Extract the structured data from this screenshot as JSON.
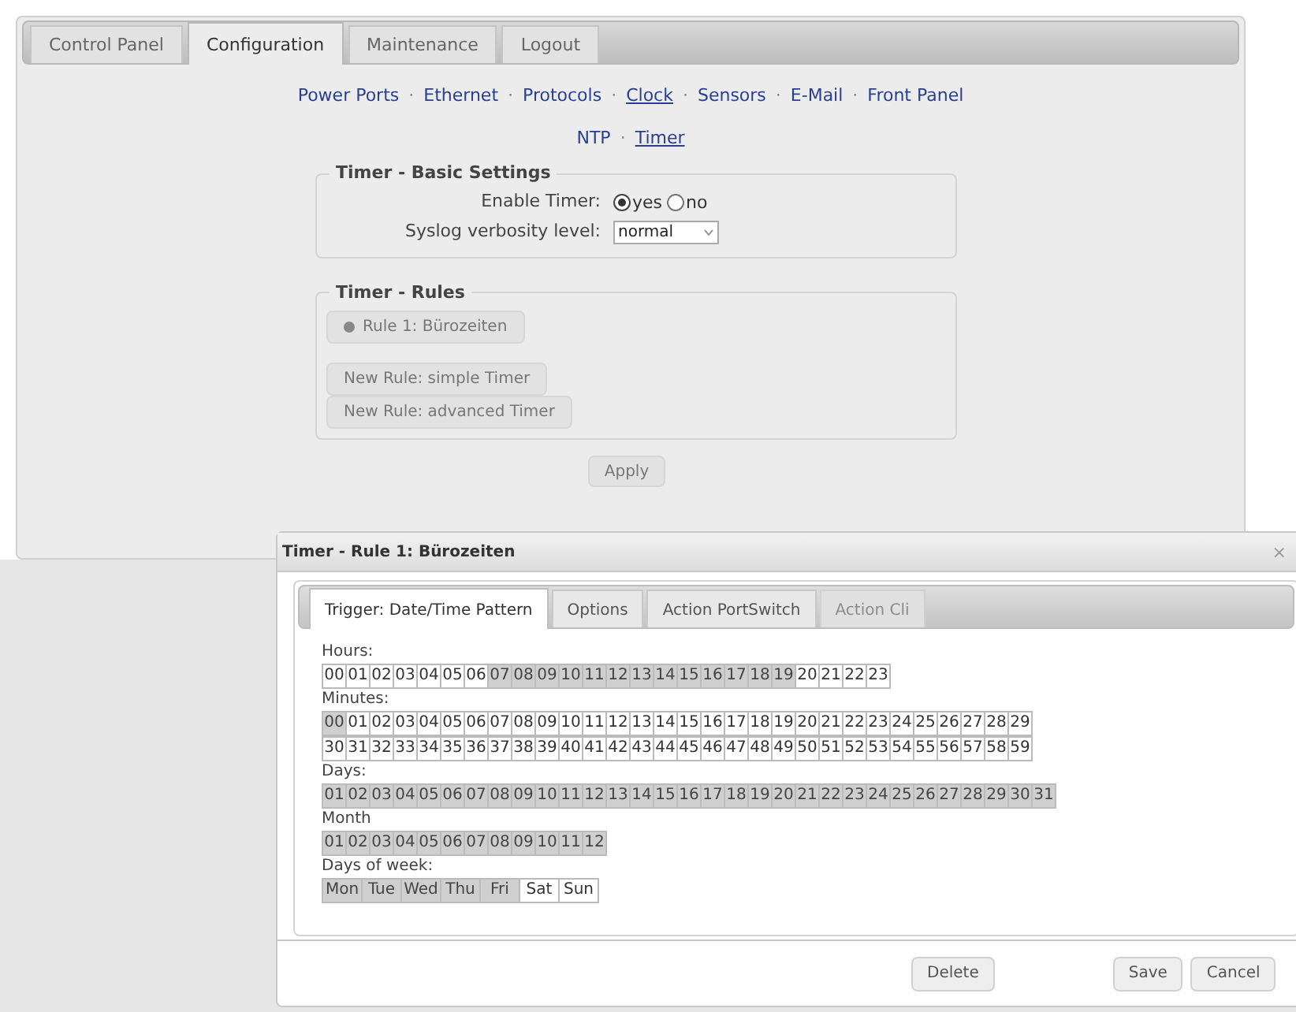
{
  "main_tabs": [
    {
      "label": "Control Panel",
      "selected": false
    },
    {
      "label": "Configuration",
      "selected": true
    },
    {
      "label": "Maintenance",
      "selected": false
    },
    {
      "label": "Logout",
      "selected": false
    }
  ],
  "separator": "·",
  "nav_links": [
    {
      "label": "Power Ports",
      "selected": false
    },
    {
      "label": "Ethernet",
      "selected": false
    },
    {
      "label": "Protocols",
      "selected": false
    },
    {
      "label": "Clock",
      "selected": true
    },
    {
      "label": "Sensors",
      "selected": false
    },
    {
      "label": "E-Mail",
      "selected": false
    },
    {
      "label": "Front Panel",
      "selected": false
    }
  ],
  "sub_links": [
    {
      "label": "NTP",
      "selected": false
    },
    {
      "label": "Timer",
      "selected": true
    }
  ],
  "basic_settings": {
    "legend": "Timer - Basic Settings",
    "fields": [
      {
        "kind": "radio",
        "label": "Enable Timer:",
        "options": [
          {
            "label": "yes",
            "selected": true
          },
          {
            "label": "no",
            "selected": false
          }
        ]
      },
      {
        "kind": "select",
        "label": "Syslog verbosity level:",
        "value": "normal"
      }
    ]
  },
  "rules": {
    "legend": "Timer - Rules",
    "buttons": [
      {
        "kind": "rule",
        "label": "Rule 1: Bürozeiten"
      },
      {
        "kind": "new",
        "label": "New Rule: simple Timer"
      },
      {
        "kind": "new",
        "label": "New Rule: advanced Timer"
      }
    ]
  },
  "apply_button": "Apply",
  "dialog": {
    "title": "Timer - Rule 1: Bürozeiten",
    "close": "×",
    "tabs": [
      {
        "label": "Trigger: Date/Time Pattern",
        "selected": true,
        "disabled": false
      },
      {
        "label": "Options",
        "selected": false,
        "disabled": false
      },
      {
        "label": "Action PortSwitch",
        "selected": false,
        "disabled": false
      },
      {
        "label": "Action Cli",
        "selected": false,
        "disabled": true
      }
    ],
    "groups": [
      {
        "label": "Hours:",
        "kind": "number",
        "rows": [
          [
            {
              "label": "00",
              "selected": false
            },
            {
              "label": "01",
              "selected": false
            },
            {
              "label": "02",
              "selected": false
            },
            {
              "label": "03",
              "selected": false
            },
            {
              "label": "04",
              "selected": false
            },
            {
              "label": "05",
              "selected": false
            },
            {
              "label": "06",
              "selected": false
            },
            {
              "label": "07",
              "selected": true
            },
            {
              "label": "08",
              "selected": true
            },
            {
              "label": "09",
              "selected": true
            },
            {
              "label": "10",
              "selected": true
            },
            {
              "label": "11",
              "selected": true
            },
            {
              "label": "12",
              "selected": true
            },
            {
              "label": "13",
              "selected": true
            },
            {
              "label": "14",
              "selected": true
            },
            {
              "label": "15",
              "selected": true
            },
            {
              "label": "16",
              "selected": true
            },
            {
              "label": "17",
              "selected": true
            },
            {
              "label": "18",
              "selected": true
            },
            {
              "label": "19",
              "selected": true
            },
            {
              "label": "20",
              "selected": false
            },
            {
              "label": "21",
              "selected": false
            },
            {
              "label": "22",
              "selected": false
            },
            {
              "label": "23",
              "selected": false
            }
          ]
        ]
      },
      {
        "label": "Minutes:",
        "kind": "number",
        "rows": [
          [
            {
              "label": "00",
              "selected": true
            },
            {
              "label": "01",
              "selected": false
            },
            {
              "label": "02",
              "selected": false
            },
            {
              "label": "03",
              "selected": false
            },
            {
              "label": "04",
              "selected": false
            },
            {
              "label": "05",
              "selected": false
            },
            {
              "label": "06",
              "selected": false
            },
            {
              "label": "07",
              "selected": false
            },
            {
              "label": "08",
              "selected": false
            },
            {
              "label": "09",
              "selected": false
            },
            {
              "label": "10",
              "selected": false
            },
            {
              "label": "11",
              "selected": false
            },
            {
              "label": "12",
              "selected": false
            },
            {
              "label": "13",
              "selected": false
            },
            {
              "label": "14",
              "selected": false
            },
            {
              "label": "15",
              "selected": false
            },
            {
              "label": "16",
              "selected": false
            },
            {
              "label": "17",
              "selected": false
            },
            {
              "label": "18",
              "selected": false
            },
            {
              "label": "19",
              "selected": false
            },
            {
              "label": "20",
              "selected": false
            },
            {
              "label": "21",
              "selected": false
            },
            {
              "label": "22",
              "selected": false
            },
            {
              "label": "23",
              "selected": false
            },
            {
              "label": "24",
              "selected": false
            },
            {
              "label": "25",
              "selected": false
            },
            {
              "label": "26",
              "selected": false
            },
            {
              "label": "27",
              "selected": false
            },
            {
              "label": "28",
              "selected": false
            },
            {
              "label": "29",
              "selected": false
            }
          ],
          [
            {
              "label": "30",
              "selected": false
            },
            {
              "label": "31",
              "selected": false
            },
            {
              "label": "32",
              "selected": false
            },
            {
              "label": "33",
              "selected": false
            },
            {
              "label": "34",
              "selected": false
            },
            {
              "label": "35",
              "selected": false
            },
            {
              "label": "36",
              "selected": false
            },
            {
              "label": "37",
              "selected": false
            },
            {
              "label": "38",
              "selected": false
            },
            {
              "label": "39",
              "selected": false
            },
            {
              "label": "40",
              "selected": false
            },
            {
              "label": "41",
              "selected": false
            },
            {
              "label": "42",
              "selected": false
            },
            {
              "label": "43",
              "selected": false
            },
            {
              "label": "44",
              "selected": false
            },
            {
              "label": "45",
              "selected": false
            },
            {
              "label": "46",
              "selected": false
            },
            {
              "label": "47",
              "selected": false
            },
            {
              "label": "48",
              "selected": false
            },
            {
              "label": "49",
              "selected": false
            },
            {
              "label": "50",
              "selected": false
            },
            {
              "label": "51",
              "selected": false
            },
            {
              "label": "52",
              "selected": false
            },
            {
              "label": "53",
              "selected": false
            },
            {
              "label": "54",
              "selected": false
            },
            {
              "label": "55",
              "selected": false
            },
            {
              "label": "56",
              "selected": false
            },
            {
              "label": "57",
              "selected": false
            },
            {
              "label": "58",
              "selected": false
            },
            {
              "label": "59",
              "selected": false
            }
          ]
        ]
      },
      {
        "label": "Days:",
        "kind": "number",
        "rows": [
          [
            {
              "label": "01",
              "selected": true
            },
            {
              "label": "02",
              "selected": true
            },
            {
              "label": "03",
              "selected": true
            },
            {
              "label": "04",
              "selected": true
            },
            {
              "label": "05",
              "selected": true
            },
            {
              "label": "06",
              "selected": true
            },
            {
              "label": "07",
              "selected": true
            },
            {
              "label": "08",
              "selected": true
            },
            {
              "label": "09",
              "selected": true
            },
            {
              "label": "10",
              "selected": true
            },
            {
              "label": "11",
              "selected": true
            },
            {
              "label": "12",
              "selected": true
            },
            {
              "label": "13",
              "selected": true
            },
            {
              "label": "14",
              "selected": true
            },
            {
              "label": "15",
              "selected": true
            },
            {
              "label": "16",
              "selected": true
            },
            {
              "label": "17",
              "selected": true
            },
            {
              "label": "18",
              "selected": true
            },
            {
              "label": "19",
              "selected": true
            },
            {
              "label": "20",
              "selected": true
            },
            {
              "label": "21",
              "selected": true
            },
            {
              "label": "22",
              "selected": true
            },
            {
              "label": "23",
              "selected": true
            },
            {
              "label": "24",
              "selected": true
            },
            {
              "label": "25",
              "selected": true
            },
            {
              "label": "26",
              "selected": true
            },
            {
              "label": "27",
              "selected": true
            },
            {
              "label": "28",
              "selected": true
            },
            {
              "label": "29",
              "selected": true
            },
            {
              "label": "30",
              "selected": true
            },
            {
              "label": "31",
              "selected": true
            }
          ]
        ]
      },
      {
        "label": "Month",
        "kind": "number",
        "rows": [
          [
            {
              "label": "01",
              "selected": true
            },
            {
              "label": "02",
              "selected": true
            },
            {
              "label": "03",
              "selected": true
            },
            {
              "label": "04",
              "selected": true
            },
            {
              "label": "05",
              "selected": true
            },
            {
              "label": "06",
              "selected": true
            },
            {
              "label": "07",
              "selected": true
            },
            {
              "label": "08",
              "selected": true
            },
            {
              "label": "09",
              "selected": true
            },
            {
              "label": "10",
              "selected": true
            },
            {
              "label": "11",
              "selected": true
            },
            {
              "label": "12",
              "selected": true
            }
          ]
        ]
      },
      {
        "label": "Days of week:",
        "kind": "word",
        "rows": [
          [
            {
              "label": "Mon",
              "selected": true
            },
            {
              "label": "Tue",
              "selected": true
            },
            {
              "label": "Wed",
              "selected": true
            },
            {
              "label": "Thu",
              "selected": true
            },
            {
              "label": "Fri",
              "selected": true
            },
            {
              "label": "Sat",
              "selected": false
            },
            {
              "label": "Sun",
              "selected": false
            }
          ]
        ]
      }
    ],
    "buttons": [
      {
        "kind": "danger",
        "label": "Delete"
      },
      {
        "kind": "normal",
        "label": "Save"
      },
      {
        "kind": "normal",
        "label": "Cancel"
      }
    ]
  }
}
